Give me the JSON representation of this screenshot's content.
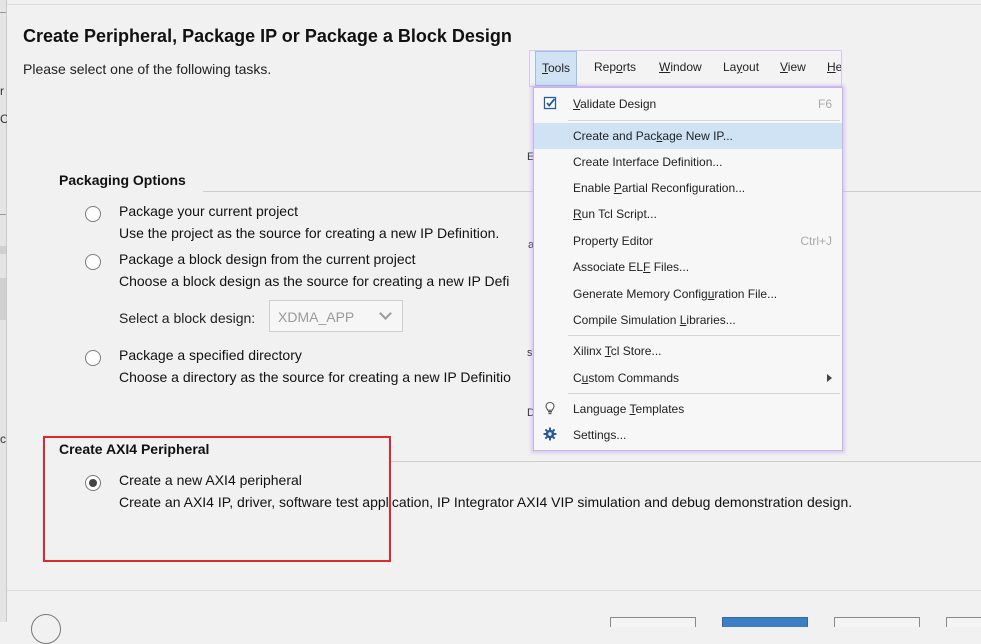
{
  "wizard": {
    "title": "Create Peripheral, Package IP or Package a Block Design",
    "subtitle": "Please select one of the following tasks.",
    "packaging": {
      "heading": "Packaging Options",
      "options": [
        {
          "title": "Package your current project",
          "desc": "Use the project as the source for creating a new IP Definition.",
          "selected": false
        },
        {
          "title": "Package a block design from the current project",
          "desc": "Choose a block design as the source for creating a new IP Defi",
          "selected": false
        },
        {
          "title": "Package a specified directory",
          "desc": "Choose a directory as the source for creating a new IP Definitio",
          "selected": false
        }
      ],
      "block_design_label": "Select a block design:",
      "block_design_value": "XDMA_APP"
    },
    "axi": {
      "heading": "Create AXI4 Peripheral",
      "option": {
        "title": "Create a new AXI4 peripheral",
        "desc": "Create an AXI4 IP, driver, software test application, IP Integrator AXI4 VIP simulation and debug demonstration design.",
        "selected": true
      }
    }
  },
  "background_fragments": {
    "left": [
      "r",
      "C",
      "c"
    ],
    "behind_menu": [
      "E",
      "a",
      "si",
      "De"
    ]
  },
  "menubar": {
    "items": [
      {
        "pre": "",
        "mn": "T",
        "post": "ools",
        "active": true
      },
      {
        "pre": "Rep",
        "mn": "o",
        "post": "rts",
        "active": false
      },
      {
        "pre": "",
        "mn": "W",
        "post": "indow",
        "active": false
      },
      {
        "pre": "La",
        "mn": "y",
        "post": "out",
        "active": false
      },
      {
        "pre": "",
        "mn": "V",
        "post": "iew",
        "active": false
      },
      {
        "pre": "",
        "mn": "H",
        "post": "e",
        "active": false
      }
    ]
  },
  "menu": {
    "items": [
      {
        "pre": "",
        "mn": "V",
        "post": "alidate Design",
        "shortcut": "F6",
        "icon": "validate-check-icon"
      },
      {
        "pre": "Create and Pac",
        "mn": "k",
        "post": "age New IP...",
        "shortcut": "",
        "icon": "",
        "highlight": true
      },
      {
        "pre": "Create Interface Definition...",
        "mn": "",
        "post": "",
        "shortcut": "",
        "icon": ""
      },
      {
        "pre": "Enable ",
        "mn": "P",
        "post": "artial Reconfiguration...",
        "shortcut": "",
        "icon": ""
      },
      {
        "pre": "",
        "mn": "R",
        "post": "un Tcl Script...",
        "shortcut": "",
        "icon": ""
      },
      {
        "pre": "Property Editor",
        "mn": "",
        "post": "",
        "shortcut": "Ctrl+J",
        "icon": ""
      },
      {
        "pre": "Associate EL",
        "mn": "F",
        "post": " Files...",
        "shortcut": "",
        "icon": ""
      },
      {
        "pre": "Generate Memory Config",
        "mn": "u",
        "post": "ration File...",
        "shortcut": "",
        "icon": ""
      },
      {
        "pre": "Compile Simulation ",
        "mn": "L",
        "post": "ibraries...",
        "shortcut": "",
        "icon": ""
      },
      {
        "pre": "Xilinx ",
        "mn": "T",
        "post": "cl Store...",
        "shortcut": "",
        "icon": ""
      },
      {
        "pre": "C",
        "mn": "u",
        "post": "stom Commands",
        "shortcut": "",
        "icon": "",
        "submenu": true
      },
      {
        "pre": "Language ",
        "mn": "T",
        "post": "emplates",
        "shortcut": "",
        "icon": "lightbulb-icon"
      },
      {
        "pre": "Settings...",
        "mn": "",
        "post": "",
        "shortcut": "",
        "icon": "gear-icon"
      }
    ]
  }
}
